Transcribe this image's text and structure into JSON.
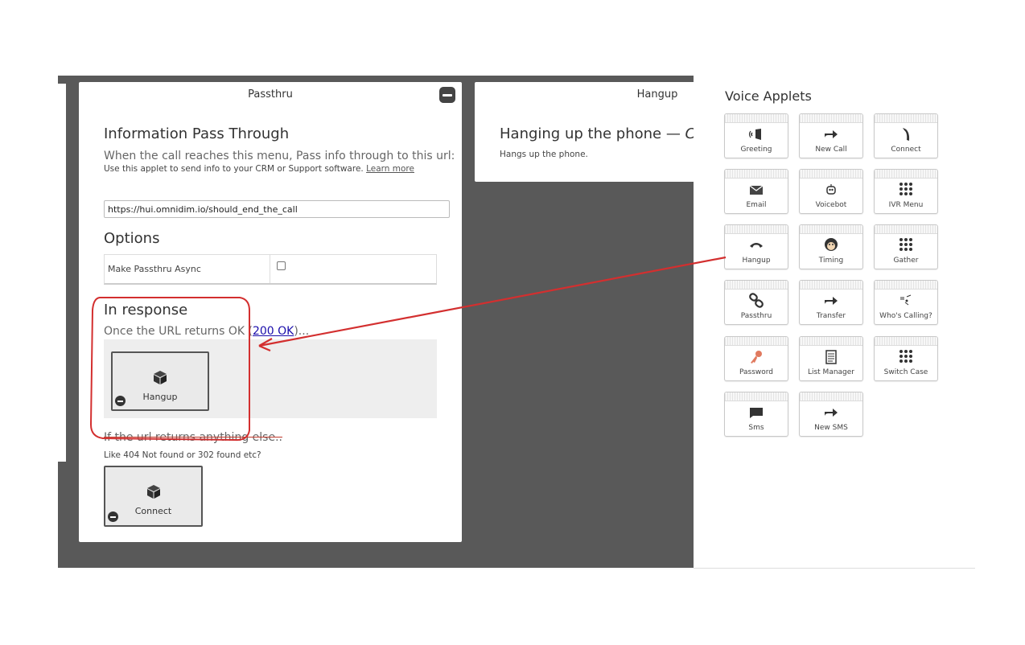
{
  "passthru_panel": {
    "title": "Passthru",
    "heading": "Information Pass Through",
    "description": "When the call reaches this menu, Pass info through to this url:",
    "help": "Use this applet to send info to your CRM or Support software.",
    "learn_more": "Learn more",
    "url_value": "https://hui.omnidim.io/should_end_the_call",
    "options_heading": "Options",
    "option_label": "Make Passthru Async",
    "in_response_heading": "In response",
    "ok_text_before": "Once the URL returns OK (",
    "ok_link": "200 OK",
    "ok_text_after": ")...",
    "ok_applet": "Hangup",
    "else_text": "If the url returns anything else..",
    "else_help": "Like 404 Not found or 302 found etc?",
    "else_applet": "Connect"
  },
  "hangup_panel": {
    "title": "Hangup",
    "heading": "Hanging up the phone — ",
    "heading_italic": "Clac",
    "description": "Hangs up the phone."
  },
  "sidebar": {
    "title": "Voice Applets",
    "tiles": [
      {
        "label": "Greeting",
        "icon": "speaker-icon"
      },
      {
        "label": "New Call",
        "icon": "forward-arrow-icon"
      },
      {
        "label": "Connect",
        "icon": "phone-handset-icon"
      },
      {
        "label": "Email",
        "icon": "envelope-icon"
      },
      {
        "label": "Voicebot",
        "icon": "robot-icon"
      },
      {
        "label": "IVR Menu",
        "icon": "keypad-icon"
      },
      {
        "label": "Hangup",
        "icon": "hangup-icon"
      },
      {
        "label": "Timing",
        "icon": "monkey-icon"
      },
      {
        "label": "Gather",
        "icon": "keypad-icon"
      },
      {
        "label": "Passthru",
        "icon": "chain-link-icon"
      },
      {
        "label": "Transfer",
        "icon": "forward-arrow-icon"
      },
      {
        "label": "Who's Calling?",
        "icon": "caller-id-icon"
      },
      {
        "label": "Password",
        "icon": "key-icon"
      },
      {
        "label": "List Manager",
        "icon": "document-list-icon"
      },
      {
        "label": "Switch Case",
        "icon": "keypad-icon"
      },
      {
        "label": "Sms",
        "icon": "chat-bubble-icon"
      },
      {
        "label": "New SMS",
        "icon": "forward-arrow-icon"
      }
    ]
  },
  "colors": {
    "canvas_bg": "#595959",
    "annotation_red": "#d32f2f",
    "link_blue": "#1a0dab"
  }
}
